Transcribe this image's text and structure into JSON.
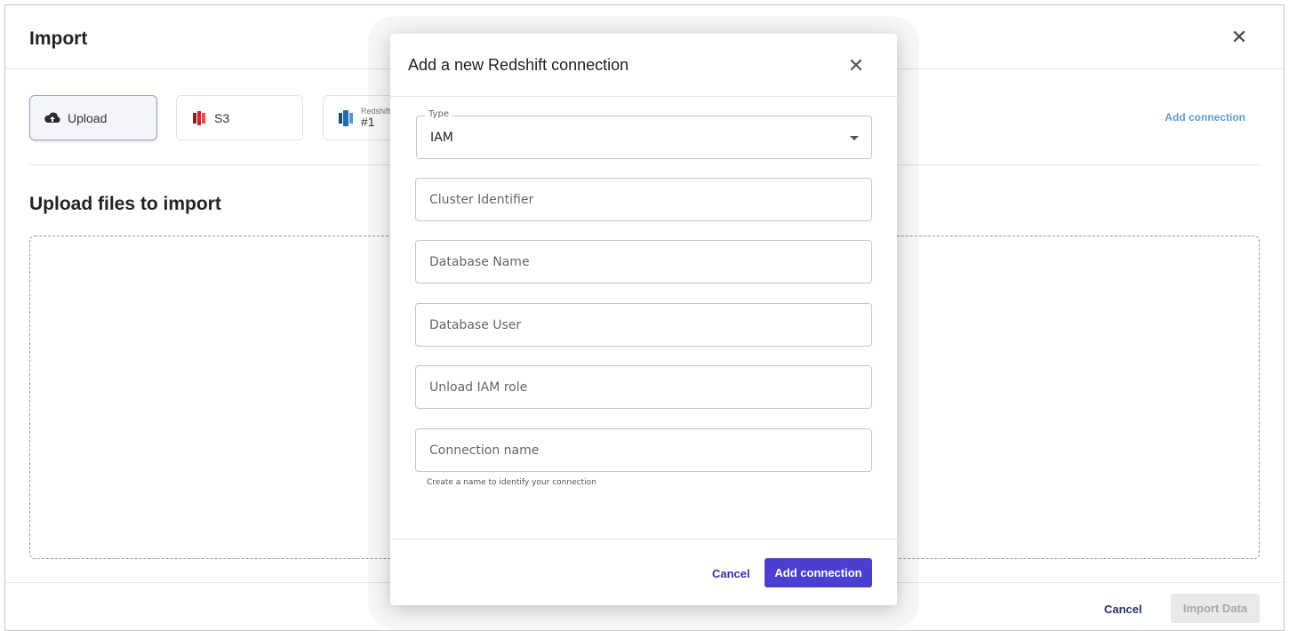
{
  "page": {
    "title": "Import",
    "sources": [
      {
        "label": "Upload",
        "icon": "cloud-upload-icon",
        "active": true
      },
      {
        "label": "S3",
        "icon": "s3-bucket-icon",
        "active": false
      },
      {
        "label_small": "Redshift",
        "label_num": "#1",
        "icon": "redshift-icon",
        "active": false
      }
    ],
    "add_connection_link": "Add connection",
    "section_title": "Upload files to import",
    "footer": {
      "cancel": "Cancel",
      "import": "Import Data"
    }
  },
  "modal": {
    "title": "Add a new Redshift connection",
    "type_field": {
      "legend": "Type",
      "value": "IAM"
    },
    "fields": [
      {
        "placeholder": "Cluster Identifier"
      },
      {
        "placeholder": "Database Name"
      },
      {
        "placeholder": "Database User"
      },
      {
        "placeholder": "Unload IAM role"
      },
      {
        "placeholder": "Connection name"
      }
    ],
    "helper_text": "Create a name to identify your connection",
    "cancel": "Cancel",
    "submit": "Add connection"
  },
  "colors": {
    "primary": "#4b3fd1",
    "link": "#5a9fd0",
    "s3": "#c7272a",
    "redshift": "#1f6fb2"
  }
}
